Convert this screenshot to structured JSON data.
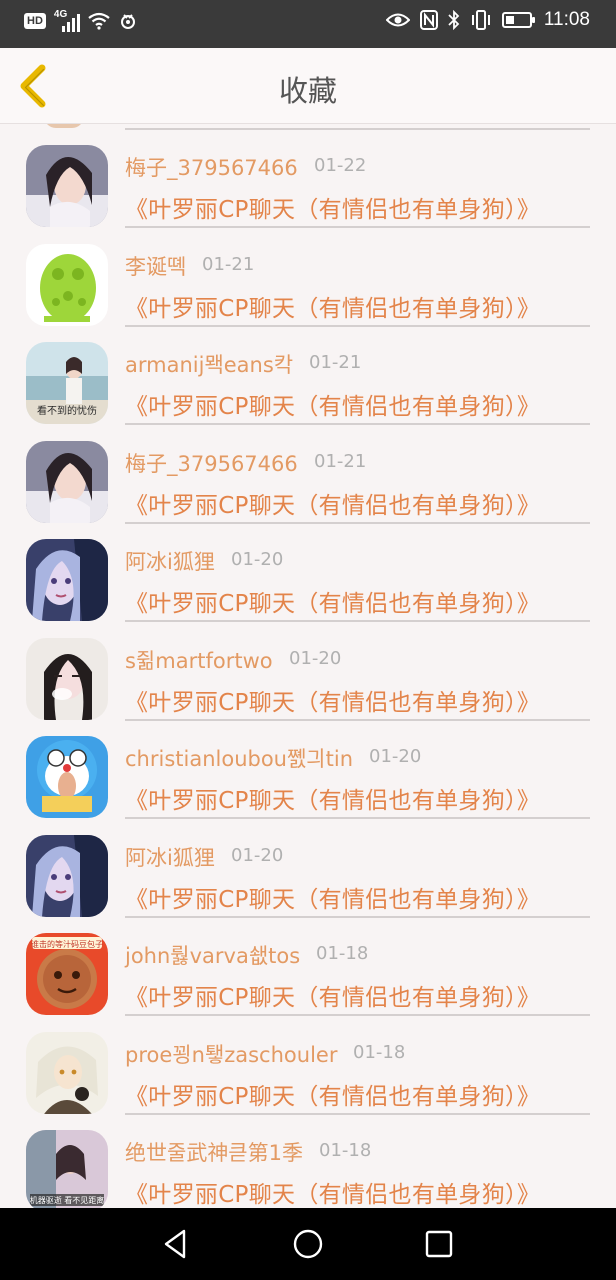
{
  "status_bar": {
    "hd_label": "HD",
    "network_label": "4G",
    "time": "11:08",
    "battery_level": 0.35,
    "icons": [
      "hd-icon",
      "signal-4g-icon",
      "wifi-icon",
      "app-notification-icon",
      "eye-icon",
      "nfc-icon",
      "bluetooth-icon",
      "vibrate-icon",
      "battery-icon"
    ]
  },
  "header": {
    "title": "收藏",
    "back_icon": "chevron-left-icon",
    "accent_color": "#e8b800"
  },
  "favorites": [
    {
      "name": "梅子_379567466",
      "date": "01-22",
      "message": "《叶罗丽CP聊天（有情侣也有单身狗）》"
    },
    {
      "name": "李诞뗵",
      "date": "01-21",
      "message": "《叶罗丽CP聊天（有情侣也有单身狗）》"
    },
    {
      "name": "armanij뫡eans칵",
      "date": "01-21",
      "message": "《叶罗丽CP聊天（有情侣也有单身狗）》",
      "avatar_caption": "看不到的忧伤"
    },
    {
      "name": "梅子_379567466",
      "date": "01-21",
      "message": "《叶罗丽CP聊天（有情侣也有单身狗）》"
    },
    {
      "name": "阿冰i狐狸",
      "date": "01-20",
      "message": "《叶罗丽CP聊天（有情侣也有单身狗）》"
    },
    {
      "name": "s쥚martfortwo",
      "date": "01-20",
      "message": "《叶罗丽CP聊天（有情侣也有单身狗）》"
    },
    {
      "name": "christianloubou쪬긔tin",
      "date": "01-20",
      "message": "《叶罗丽CP聊天（有情侣也有单身狗）》"
    },
    {
      "name": "阿冰i狐狸",
      "date": "01-20",
      "message": "《叶罗丽CP聊天（有情侣也有单身狗）》"
    },
    {
      "name": "john뤓varva쇖tos",
      "date": "01-18",
      "message": "《叶罗丽CP聊天（有情侣也有单身狗）》",
      "avatar_caption": "谁击的等汁码豆包子"
    },
    {
      "name": "proe꾕n퇳zaschouler",
      "date": "01-18",
      "message": "《叶罗丽CP聊天（有情侣也有单身狗）》"
    },
    {
      "name": "绝世줄武神큳第1季",
      "date": "01-18",
      "message": "《叶罗丽CP聊天（有情侣也有单身狗）》",
      "avatar_caption": "机器驱逝 看不见距离"
    }
  ],
  "nav_bar": {
    "back_icon": "triangle-back-icon",
    "home_icon": "circle-home-icon",
    "recents_icon": "square-recents-icon"
  },
  "colors": {
    "name_text": "#e39a63",
    "message_text": "#e3844a",
    "date_text": "#b0b0b0",
    "divider": "#d4cfcf",
    "page_bg": "#f8f4f4"
  }
}
